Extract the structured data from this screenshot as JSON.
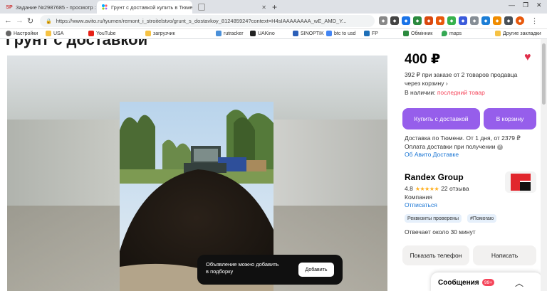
{
  "browser": {
    "tabs": [
      {
        "label": "Задание №2987685 - просмотр з",
        "icon": "SP"
      },
      {
        "label": "Грунт с доставкой купить в Тюме",
        "icon": "avito"
      },
      {
        "label": "",
        "icon": "blank"
      }
    ],
    "url": "https://www.avito.ru/tyumen/remont_i_stroitelstvo/grunt_s_dostavkoy_812485924?context=H4sIAAAAAAAA_wE_AMD_Y...",
    "bookmarks": [
      "Настройки",
      "USA",
      "YouTube",
      "загрузчик",
      "rutracker",
      "UAKino",
      "SINOPTIK",
      "btc to usd",
      "FP",
      "Обмінник",
      "maps",
      "Другие закладки"
    ]
  },
  "page": {
    "title": "Грунт с доставкой",
    "price": "400 ₽",
    "subprice": "392 ₽ при заказе от 2 товаров продавца через корзину",
    "availability_label": "В наличии:",
    "availability_value": "последний товар",
    "buy_button": "Купить с доставкой",
    "cart_button": "В корзину",
    "delivery_line1": "Доставка по Тюмени. От 1 дня, от 2379 ₽",
    "delivery_line2": "Оплата доставки при получении",
    "delivery_link": "Об Авито Доставке",
    "seller": {
      "name": "Randex Group",
      "rating": "4.8",
      "reviews": "22 отзыва",
      "type": "Компания",
      "subscribe": "Отписаться",
      "badges": [
        "Реквизиты проверены",
        "#Помогаю"
      ],
      "response_time": "Отвечает около 30 минут"
    },
    "show_phone_button": "Показать телефон",
    "write_button": "Написать",
    "toast": {
      "text_line1": "Объявление можно добавить",
      "text_line2": "в подборку",
      "button": "Добавить"
    },
    "messages": {
      "label": "Сообщения",
      "count": "99+"
    }
  },
  "colors": {
    "accent": "#965eeb",
    "link": "#1975d4",
    "alert": "#f5455a",
    "star": "#ffb021"
  }
}
